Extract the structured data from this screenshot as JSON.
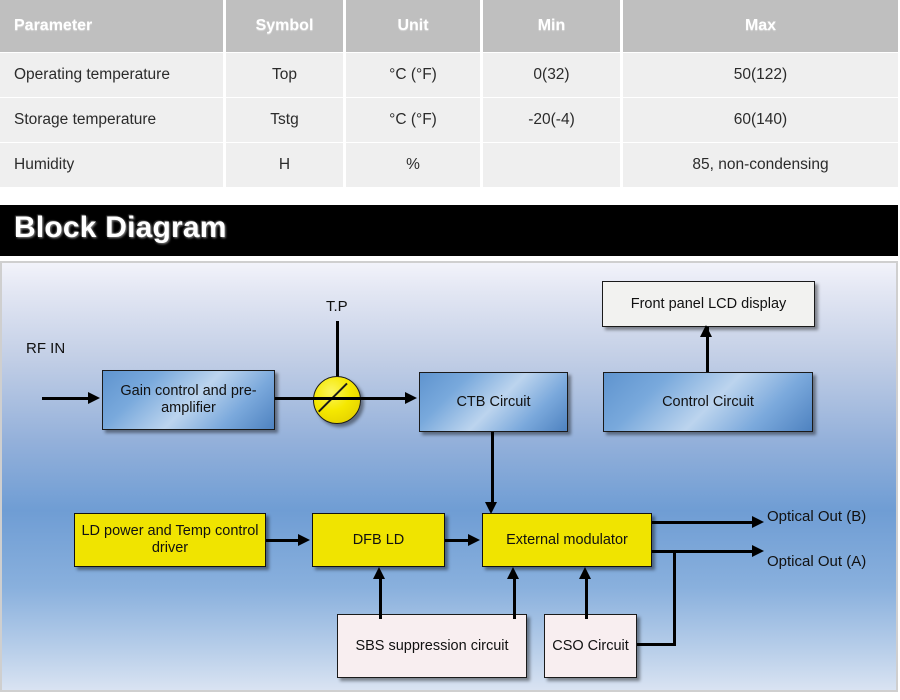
{
  "spec_table": {
    "columns": [
      "Parameter",
      "Symbol",
      "Unit",
      "Min",
      "Max"
    ],
    "rows": [
      {
        "parameter": "Operating temperature",
        "symbol": "Top",
        "unit": "°C (°F)",
        "min": "0(32)",
        "max": "50(122)"
      },
      {
        "parameter": "Storage temperature",
        "symbol": "Tstg",
        "unit": "°C (°F)",
        "min": "-20(-4)",
        "max": "60(140)"
      },
      {
        "parameter": "Humidity",
        "symbol": "H",
        "unit": "%",
        "min": "",
        "max": "85, non-condensing"
      }
    ],
    "header_bg": "#bfbfbf",
    "cell_bg": "#efefef"
  },
  "section": {
    "title": "Block Diagram",
    "title_bar_bg": "#000000",
    "title_color": "#ffffff"
  },
  "diagram": {
    "labels": {
      "rf_in": "RF IN",
      "test_point": "T.P",
      "optical_out_b": "Optical Out (B)",
      "optical_out_a": "Optical Out (A)"
    },
    "blocks": {
      "gain_control": "Gain control and pre-amplifier",
      "ctb_circuit": "CTB Circuit",
      "front_panel_lcd": "Front panel LCD display",
      "control_circuit": "Control Circuit",
      "ld_driver": "LD power and Temp control driver",
      "dfb_ld": "DFB LD",
      "external_modulator": "External modulator",
      "sbs_circuit": "SBS suppression circuit",
      "cso_circuit": "CSO Circuit"
    },
    "colors": {
      "blue_block": "#79a9dc",
      "yellow_block": "#f0e400",
      "white_block": "#f2f2f0",
      "pink_block": "#f8eef0",
      "connector": "#000000",
      "background_top": "#f2f3fa",
      "background_mid": "#6f9dd4"
    }
  }
}
